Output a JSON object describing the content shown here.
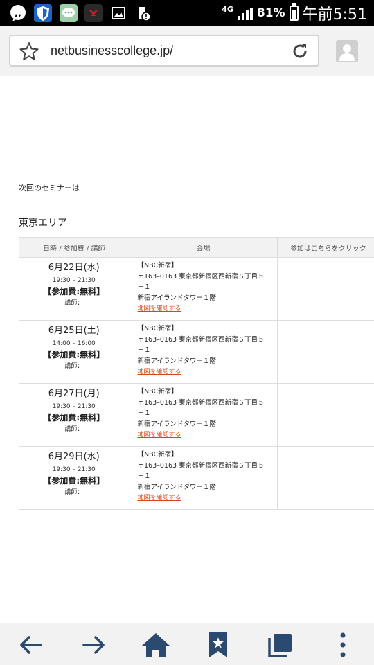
{
  "status_bar": {
    "network": "4G",
    "battery": "81%",
    "time": "午前5:51"
  },
  "browser": {
    "url": "netbusinesscollege.jp/"
  },
  "page": {
    "intro": "次回のセミナーは",
    "area_title": "東京エリア",
    "table_headers": [
      "日時 / 参加費 / 講師",
      "会場",
      "参加はこちらをクリック"
    ],
    "rows": [
      {
        "date": "6月22日(水)",
        "time": "19:30 – 21:30",
        "fee": "【参加費:無料】",
        "lecturer": "講師：",
        "venue_name": "【NBC新宿】",
        "address1": "〒163–0163 東京都新宿区西新宿６丁目５",
        "address2": "－１",
        "building": "新宿アイランドタワー１階",
        "map_link": "地図を確認する"
      },
      {
        "date": "6月25日(土)",
        "time": "14:00 – 16:00",
        "fee": "【参加費:無料】",
        "lecturer": "講師：",
        "venue_name": "【NBC新宿】",
        "address1": "〒163–0163 東京都新宿区西新宿６丁目５",
        "address2": "－１",
        "building": "新宿アイランドタワー１階",
        "map_link": "地図を確認する"
      },
      {
        "date": "6月27日(月)",
        "time": "19:30 – 21:30",
        "fee": "【参加費:無料】",
        "lecturer": "講師：",
        "venue_name": "【NBC新宿】",
        "address1": "〒163–0163 東京都新宿区西新宿６丁目５",
        "address2": "－１",
        "building": "新宿アイランドタワー１階",
        "map_link": "地図を確認する"
      },
      {
        "date": "6月29日(水)",
        "time": "19:30 – 21:30",
        "fee": "【参加費:無料】",
        "lecturer": "講師：",
        "venue_name": "【NBC新宿】",
        "address1": "〒163–0163 東京都新宿区西新宿６丁目５",
        "address2": "－１",
        "building": "新宿アイランドタワー１階",
        "map_link": "地図を確認する"
      }
    ]
  },
  "icons": {
    "status": [
      "chat-bubble-icon",
      "shield-icon",
      "message-app-icon",
      "red-app-icon",
      "gallery-icon",
      "storage-alert-icon"
    ],
    "toolbar": [
      "star-icon",
      "reload-icon",
      "profile-icon"
    ],
    "bottom_nav": [
      "back-arrow-icon",
      "forward-arrow-icon",
      "home-icon",
      "bookmarks-icon",
      "tabs-icon",
      "more-menu-icon"
    ]
  },
  "colors": {
    "status_bar": "#000000",
    "link": "#d2491c",
    "header_bg": "#f2f2f2",
    "nav_icon": "#2b4a6f"
  }
}
